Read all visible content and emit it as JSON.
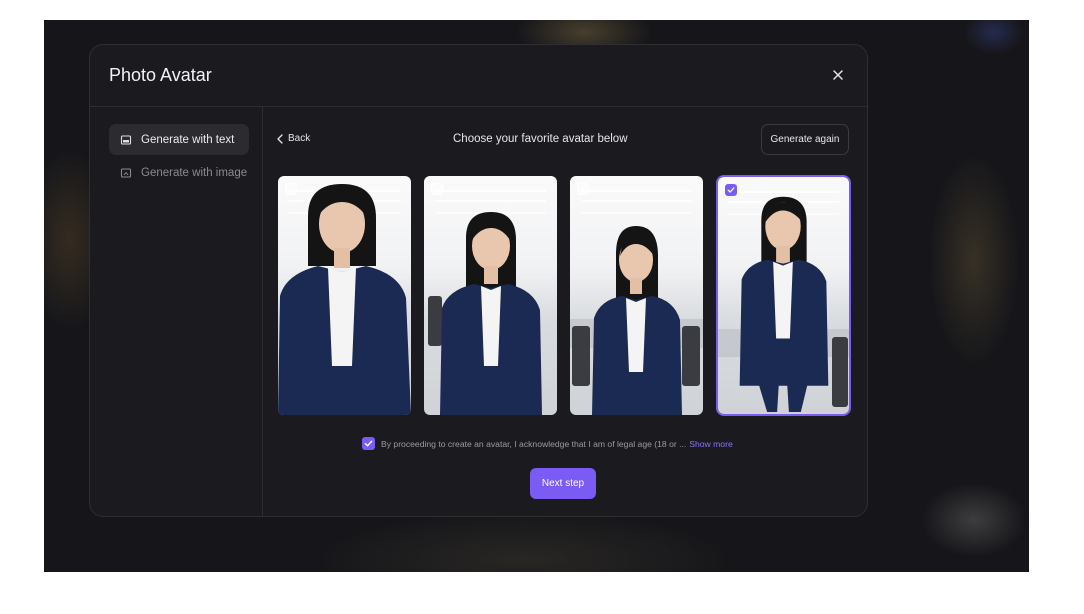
{
  "modal": {
    "title": "Photo Avatar"
  },
  "sidebar": {
    "items": [
      {
        "label": "Generate with text",
        "icon": "image-icon",
        "active": true
      },
      {
        "label": "Generate with image",
        "icon": "image-upload-icon",
        "active": false
      }
    ]
  },
  "main": {
    "back_label": "Back",
    "title": "Choose your favorite avatar below",
    "generate_again_label": "Generate again",
    "avatars": [
      {
        "selected": false
      },
      {
        "selected": false
      },
      {
        "selected": false
      },
      {
        "selected": true
      }
    ],
    "consent": {
      "checked": true,
      "text": "By proceeding to create an avatar, I acknowledge that I am of legal age (18 or ...",
      "show_more_label": "Show more"
    },
    "next_label": "Next step"
  },
  "colors": {
    "accent": "#7a5cf5",
    "modal_bg": "#1b1b1f",
    "link": "#8d73ff"
  }
}
